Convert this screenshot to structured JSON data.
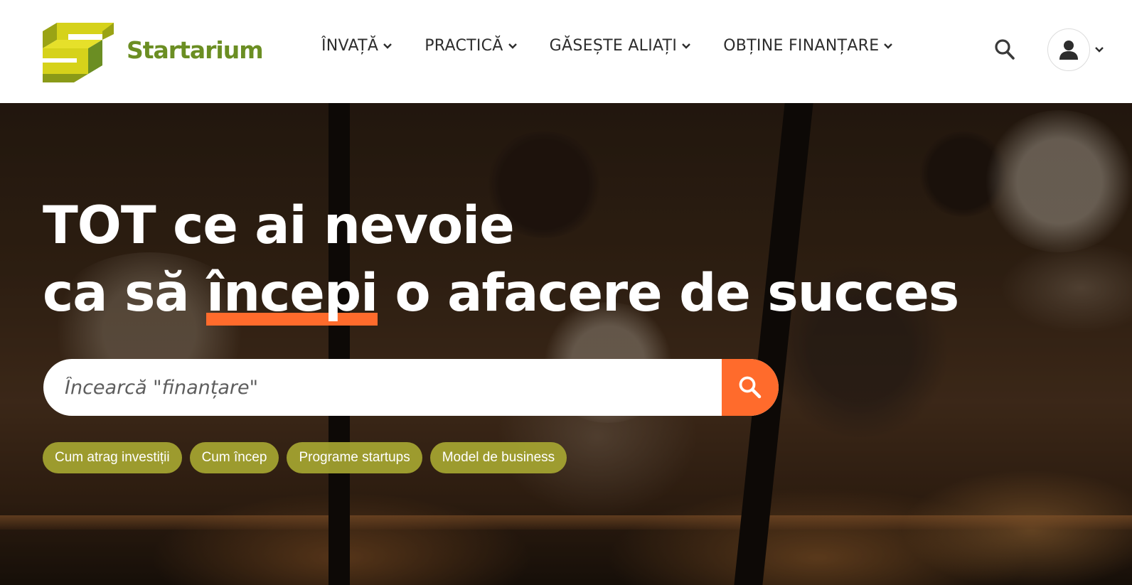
{
  "brand": {
    "name": "Startarium",
    "primary_color": "#6b8e23",
    "logo_yellow": "#d4d400",
    "accent": "#ff6b2c"
  },
  "nav": {
    "items": [
      {
        "label": "ÎNVAȚĂ"
      },
      {
        "label": "PRACTICĂ"
      },
      {
        "label": "GĂSEȘTE ALIAȚI"
      },
      {
        "label": "OBȚINE FINANȚARE"
      }
    ]
  },
  "header": {
    "search_icon": "search-icon",
    "user_icon": "user-icon"
  },
  "hero": {
    "headline_line1": "TOT ce ai nevoie",
    "headline_line2_prefix": "ca să ",
    "headline_line2_highlight": "începi",
    "headline_line2_suffix": " o afacere de succes",
    "search_placeholder": "Încearcă \"finanțare\"",
    "tags": [
      {
        "label": "Cum atrag investiții"
      },
      {
        "label": "Cum încep"
      },
      {
        "label": "Programe startups"
      },
      {
        "label": "Model de business"
      }
    ]
  }
}
